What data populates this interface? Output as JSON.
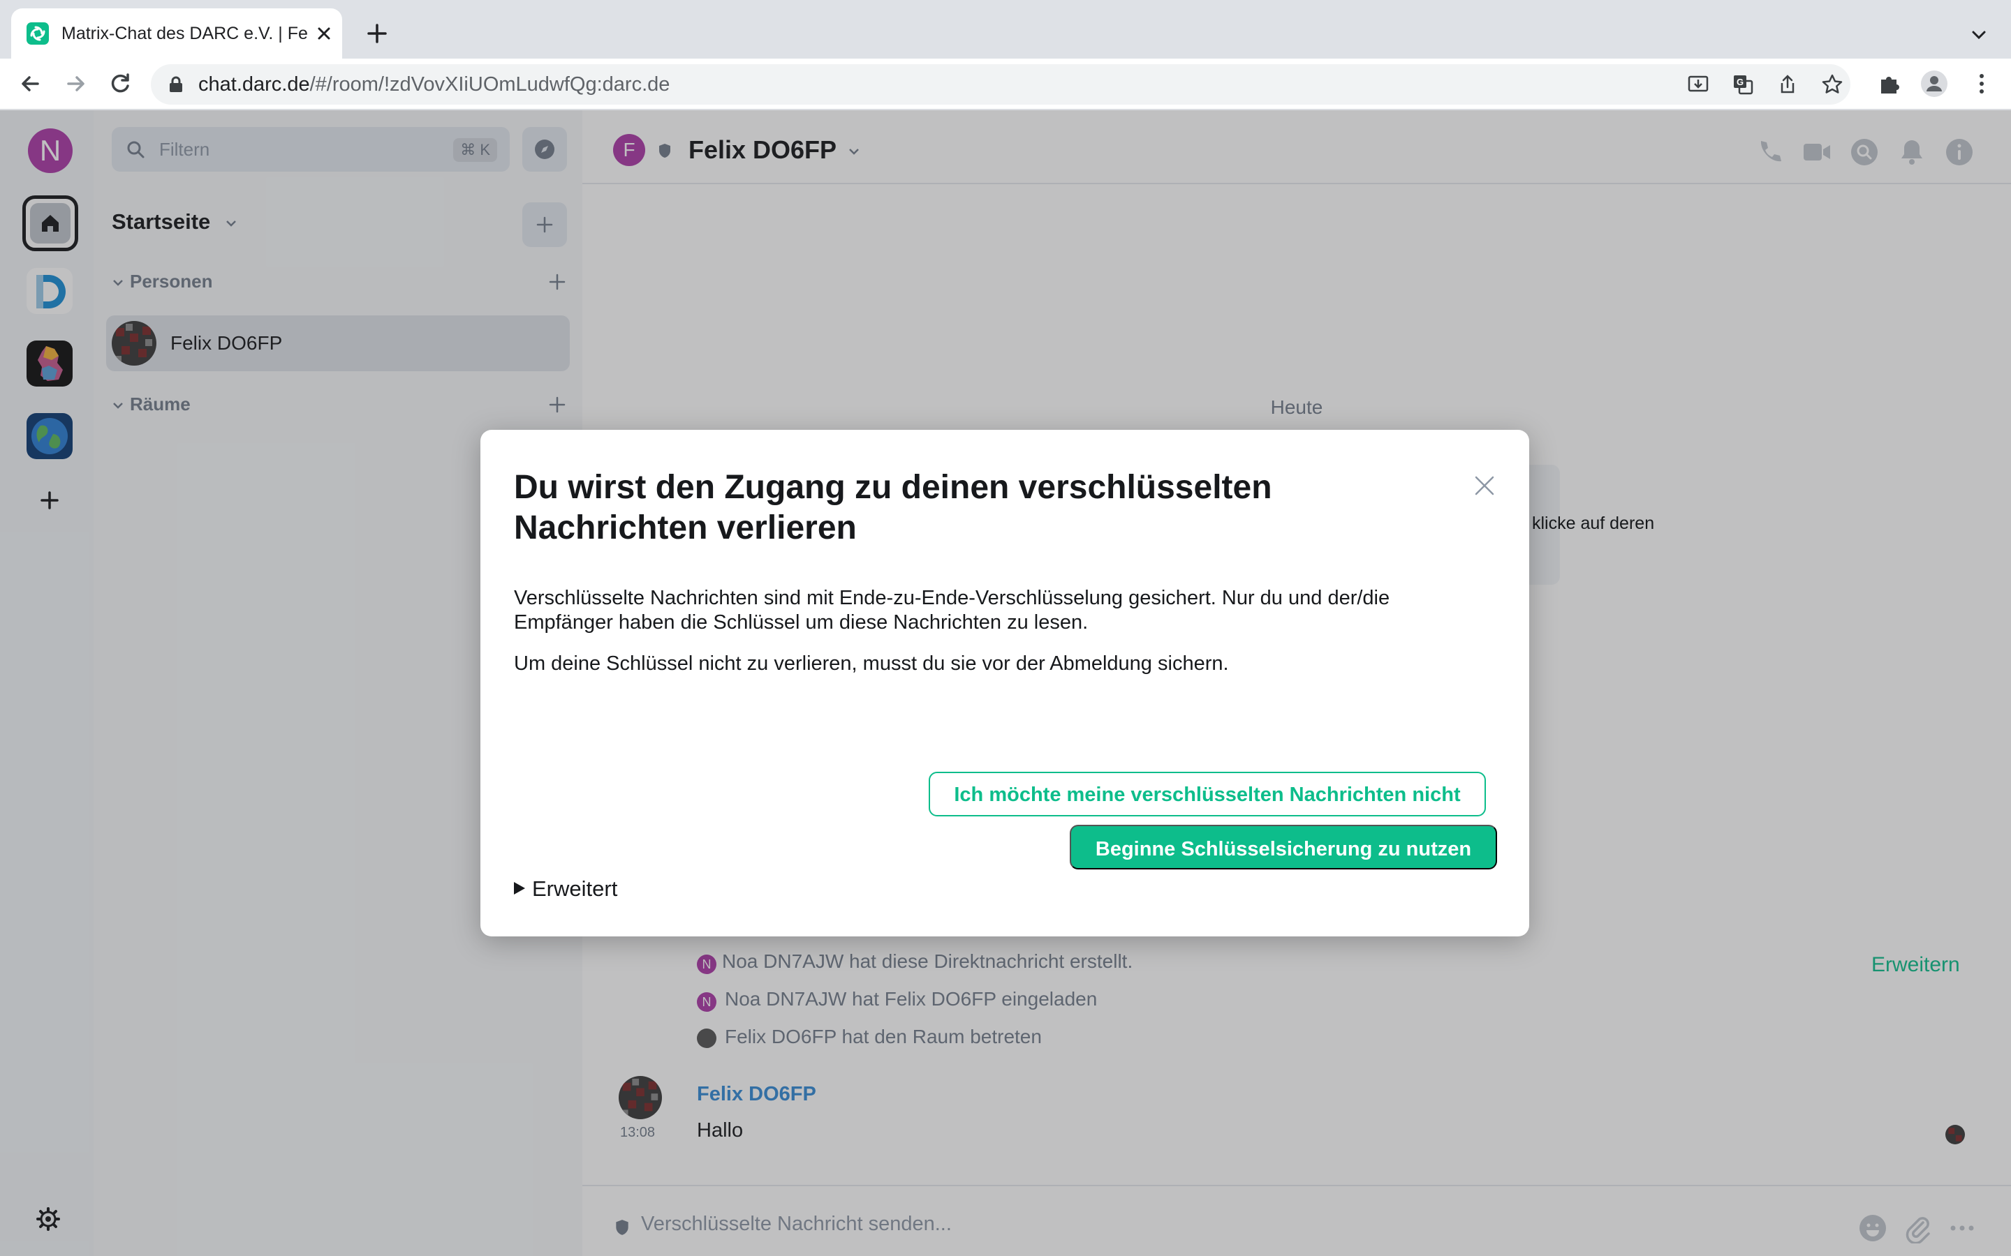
{
  "browser": {
    "tab_title": "Matrix-Chat des DARC e.V. | Fe",
    "url_host": "chat.darc.de",
    "url_path": "/#/room/!zdVovXIiUOmLudwfQg:darc.de"
  },
  "spacebar": {
    "user_initial": "N"
  },
  "roomlist": {
    "filter_placeholder": "Filtern",
    "filter_shortcut": "⌘ K",
    "home_title": "Startseite",
    "sections": [
      {
        "label": "Personen"
      },
      {
        "label": "Räume"
      }
    ],
    "dm_name": "Felix DO6FP"
  },
  "room": {
    "avatar_initial": "F",
    "name": "Felix DO6FP",
    "date_separator": "Heute",
    "notice_partial_text": "klicke auf deren",
    "events": [
      {
        "initial": "N",
        "text": "Noa DN7AJW hat diese Direktnachricht erstellt."
      },
      {
        "initial": "N",
        "text": "Noa DN7AJW hat Felix DO6FP eingeladen"
      },
      {
        "initial": "",
        "text": "Felix DO6FP hat den Raum betreten"
      }
    ],
    "expand_link": "Erweitern",
    "message": {
      "sender": "Felix DO6FP",
      "time": "13:08",
      "body": "Hallo"
    },
    "composer_placeholder": "Verschlüsselte Nachricht senden..."
  },
  "dialog": {
    "title": "Du wirst den Zugang zu deinen verschlüsselten Nachrichten verlieren",
    "paragraph1": "Verschlüsselte Nachrichten sind mit Ende-zu-Ende-Verschlüsselung gesichert. Nur du und der/die Empfänger haben die Schlüssel um diese Nachrichten zu lesen.",
    "paragraph2": "Um deine Schlüssel nicht zu verlieren, musst du sie vor der Abmeldung sichern.",
    "decline_button": "Ich möchte meine verschlüsselten Nachrichten nicht",
    "primary_button": "Beginne Schlüsselsicherung zu nutzen",
    "advanced_label": "Erweitert"
  },
  "colors": {
    "accent": "#0dbd8b",
    "user_avatar": "#ac3ba8",
    "sender_name": "#368bd6"
  }
}
